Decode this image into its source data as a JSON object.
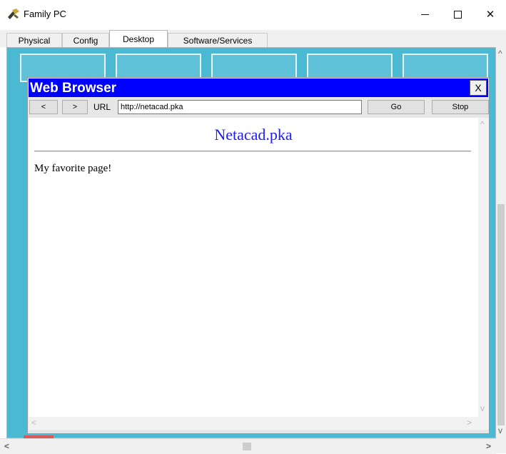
{
  "window": {
    "title": "Family PC",
    "icon": "cisco-pc-icon"
  },
  "tabs": [
    {
      "label": "Physical",
      "active": false
    },
    {
      "label": "Config",
      "active": false
    },
    {
      "label": "Desktop",
      "active": true
    },
    {
      "label": "Software/Services",
      "active": false
    }
  ],
  "browser": {
    "title": "Web Browser",
    "close_label": "X",
    "back_label": "<",
    "forward_label": ">",
    "url_label": "URL",
    "url_value": "http://netacad.pka",
    "go_label": "Go",
    "stop_label": "Stop",
    "page": {
      "heading": "Netacad.pka",
      "body": "My favorite page!"
    }
  },
  "colors": {
    "browser_title_bar": "#0000ff",
    "page_heading": "#1a1aff",
    "desktop_background": "#4bb9d1"
  }
}
